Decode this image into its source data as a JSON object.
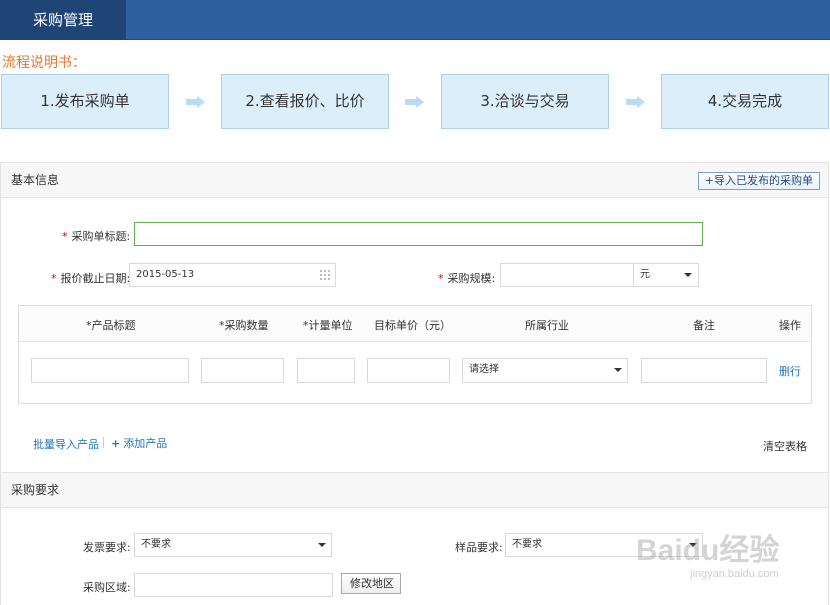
{
  "header": {
    "tab_label": "采购管理"
  },
  "process": {
    "title": "流程说明书：",
    "steps": [
      "1.发布采购单",
      "2.查看报价、比价",
      "3.洽谈与交易",
      "4.交易完成"
    ]
  },
  "basic": {
    "section_title": "基本信息",
    "import_button": "+导入已发布的采购单",
    "title_label": "采购单标题:",
    "title_value": "",
    "deadline_label": "报价截止日期:",
    "deadline_value": "2015-05-13",
    "scale_label": "采购规模:",
    "scale_value": "",
    "currency": "元"
  },
  "product_table": {
    "headers": [
      "*产品标题",
      "*采购数量",
      "*计量单位",
      "目标单价（元）",
      "所属行业",
      "备注",
      "操作"
    ],
    "row": {
      "industry_select": "请选择",
      "delete": "删行"
    }
  },
  "product_actions": {
    "batch_import": "批量导入产品",
    "add_product": "添加产品",
    "clear_table": "清空表格"
  },
  "requirements": {
    "section_title": "采购要求",
    "invoice_label": "发票要求:",
    "invoice_value": "不要求",
    "sample_label": "样品要求:",
    "sample_value": "不要求",
    "region_label": "采购区域:",
    "region_value": "",
    "edit_region_button": "修改地区"
  },
  "watermark": {
    "text": "Baidu经验",
    "sub": "jingyan.baidu.com"
  },
  "colors": {
    "header": "#2f5f9e",
    "tab": "#1f4577",
    "accent_orange": "#e8772e",
    "link": "#1f78b4",
    "required": "#dd0000",
    "step_bg": "#dbeefa"
  }
}
